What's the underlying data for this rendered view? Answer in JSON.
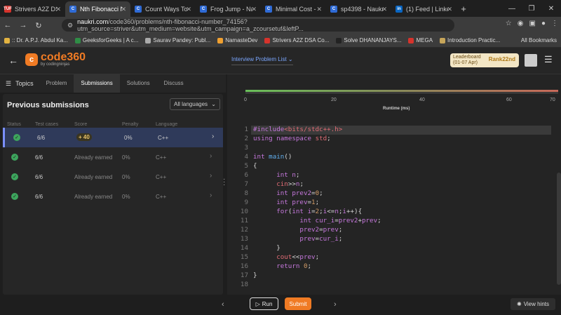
{
  "browser": {
    "tabs": [
      {
        "title": "Strivers A2Z DSA",
        "fav_color": "#d6332c",
        "fav_text": "TUF",
        "active": false
      },
      {
        "title": "Nth Fibonacci N",
        "fav_color": "#2f6bd6",
        "fav_text": "C",
        "active": true
      },
      {
        "title": "Count Ways To F",
        "fav_color": "#2f6bd6",
        "fav_text": "C",
        "active": false
      },
      {
        "title": "Frog Jump - Nau",
        "fav_color": "#2f6bd6",
        "fav_text": "C",
        "active": false
      },
      {
        "title": "Minimal Cost - N",
        "fav_color": "#2f6bd6",
        "fav_text": "C",
        "active": false
      },
      {
        "title": "sp4398 - Naukri",
        "fav_color": "#2f6bd6",
        "fav_text": "C",
        "active": false
      },
      {
        "title": "(1) Feed | Linked",
        "fav_color": "#0a66c2",
        "fav_text": "in",
        "active": false
      }
    ],
    "new_tab": "+",
    "url_host": "naukri.com",
    "url_path": "/code360/problems/nth-fibonacci-number_74156?utm_source=striver&utm_medium=website&utm_campaign=a_zcoursetuf&leftP...",
    "bookmarks": [
      {
        "label": ":: Dr. A.P.J. Abdul Ka...",
        "color": "#e3b341"
      },
      {
        "label": "GeeksforGeeks | A c...",
        "color": "#2f8d46"
      },
      {
        "label": "Saurav Pandey: Publ...",
        "color": "#aaa"
      },
      {
        "label": "NamasteDev",
        "color": "#f0a030"
      },
      {
        "label": "Strivers A2Z DSA Co...",
        "color": "#d6332c"
      },
      {
        "label": "Solve DHANANJAYS...",
        "color": "#222"
      },
      {
        "label": "MEGA",
        "color": "#d6332c"
      },
      {
        "label": "Introduction Practic...",
        "color": "#c6a55a"
      }
    ],
    "all_bookmarks": "All Bookmarks"
  },
  "header": {
    "logo_main": "code360",
    "logo_sub": "by codingninjas",
    "interview_list": "Interview Problem List",
    "leaderboard_label": "Leaderboard",
    "leaderboard_dates": "(01-07 Apr)",
    "rank_label": "Rank22nd"
  },
  "left": {
    "topics_label": "Topics",
    "tabs": [
      "Problem",
      "Submissions",
      "Solutions",
      "Discuss"
    ],
    "active_tab": "Submissions",
    "panel_title": "Previous submissions",
    "language_select": "All languages",
    "columns": [
      "Status",
      "Test cases",
      "Score",
      "Penalty",
      "Language"
    ],
    "rows": [
      {
        "test_cases": "6/6",
        "score": "+ 40",
        "penalty": "0%",
        "language": "C++",
        "selected": true
      },
      {
        "test_cases": "6/6",
        "score": "Already earned",
        "penalty": "0%",
        "language": "C++",
        "selected": false
      },
      {
        "test_cases": "6/6",
        "score": "Already earned",
        "penalty": "0%",
        "language": "C++",
        "selected": false
      },
      {
        "test_cases": "6/6",
        "score": "Already earned",
        "penalty": "0%",
        "language": "C++",
        "selected": false
      }
    ]
  },
  "runtime_chart": {
    "ticks": [
      "0",
      "20",
      "40",
      "60",
      "70"
    ],
    "xlabel": "Runtime (ms)"
  },
  "code": {
    "lines": [
      "#include<bits/stdc++.h>",
      "using namespace std;",
      "",
      "int main()",
      "{",
      "      int n;",
      "      cin>>n;",
      "      int prev2=0;",
      "      int prev=1;",
      "      for(int i=2;i<=n;i++){",
      "            int cur_i=prev2+prev;",
      "            prev2=prev;",
      "            prev=cur_i;",
      "      }",
      "      cout<<prev;",
      "      return 0;",
      "}",
      ""
    ]
  },
  "footer": {
    "run_label": "Run",
    "submit_label": "Submit",
    "hints_label": "View hints"
  }
}
